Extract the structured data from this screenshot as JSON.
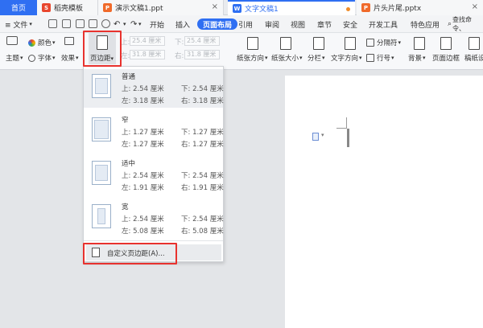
{
  "tabs": [
    {
      "label": "首页"
    },
    {
      "label": "稻壳模板"
    },
    {
      "label": "演示文稿1.ppt"
    },
    {
      "label": "文字文稿1"
    },
    {
      "label": "片头片尾.pptx"
    }
  ],
  "menubar": {
    "file": "≡ 文件",
    "start": "开始",
    "insert": "插入",
    "page_layout": "页面布局",
    "reference": "引用",
    "review": "审阅",
    "view": "视图",
    "chapter": "章节",
    "security": "安全",
    "dev_tools": "开发工具",
    "special": "特色应用",
    "search": "查找命令、"
  },
  "ribbon": {
    "color": "颜色",
    "theme": "主题",
    "font": "字体",
    "effect": "效果",
    "page_margins": "页边距",
    "top_label": "上:",
    "top_value": "25.4 厘米",
    "bottom_label": "下:",
    "bottom_value": "25.4 厘米",
    "left_label": "左:",
    "left_value": "31.8 厘米",
    "right_label": "右:",
    "right_value": "31.8 厘米",
    "orientation": "纸张方向",
    "size": "纸张大小",
    "columns": "分栏",
    "text_direction": "文字方向",
    "separator": "分隔符",
    "line_number": "行号",
    "background": "背景",
    "page_border": "页面边框",
    "draft": "稿纸设"
  },
  "margin_presets": [
    {
      "name": "普通",
      "top": "上: 2.54 厘米",
      "bottom": "下: 2.54 厘米",
      "left": "左: 3.18 厘米",
      "right": "右: 3.18 厘米"
    },
    {
      "name": "窄",
      "top": "上: 1.27 厘米",
      "bottom": "下: 1.27 厘米",
      "left": "左: 1.27 厘米",
      "right": "右: 1.27 厘米"
    },
    {
      "name": "适中",
      "top": "上: 2.54 厘米",
      "bottom": "下: 2.54 厘米",
      "left": "左: 1.91 厘米",
      "right": "右: 1.91 厘米"
    },
    {
      "name": "宽",
      "top": "上: 2.54 厘米",
      "bottom": "下: 2.54 厘米",
      "left": "左: 5.08 厘米",
      "right": "右: 5.08 厘米"
    }
  ],
  "custom_margins": "自定义页边距(A)...",
  "colors": {
    "accent": "#2f6ff2",
    "highlight": "#e8322e"
  }
}
